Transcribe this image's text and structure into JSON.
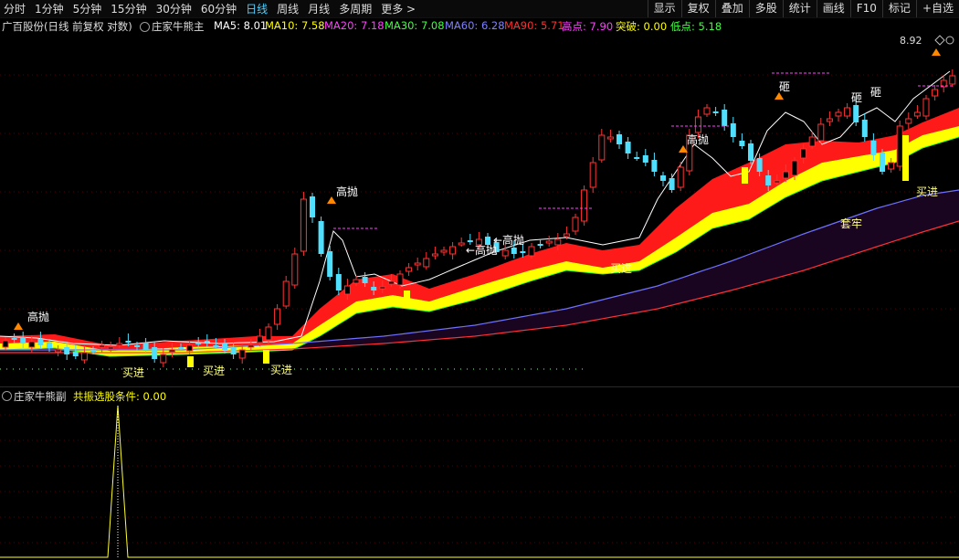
{
  "toolbar": {
    "periods": [
      "分时",
      "1分钟",
      "5分钟",
      "15分钟",
      "30分钟",
      "60分钟",
      "日线",
      "周线",
      "月线",
      "多周期",
      "更多 >"
    ],
    "active_period": "日线",
    "right_buttons": [
      "显示",
      "复权",
      "叠加",
      "多股",
      "统计",
      "画线",
      "F10",
      "标记",
      "+自选"
    ]
  },
  "info": {
    "stock": "广百股份(日线 前复权 对数)",
    "indicator": "庄家牛熊主",
    "ma5": "MA5: 8.01",
    "ma10": "MA10: 7.58",
    "ma20": "MA20: 7.18",
    "ma30": "MA30: 7.08",
    "ma60": "MA60: 6.28",
    "ma90": "MA90: 5.71",
    "high": "高点: 7.90",
    "breakout": "突破: 0.00",
    "low": "低点: 5.18",
    "colors": {
      "ma5": "#ffffff",
      "ma10": "#ffff00",
      "ma20": "#ff40ff",
      "ma30": "#40ff40",
      "ma60": "#8080ff",
      "ma90": "#ff3030",
      "high": "#ff40ff",
      "breakout": "#ffff00",
      "low": "#40ff40"
    }
  },
  "price_marker": "8.92",
  "annotations": [
    {
      "text": "高抛",
      "kind": "sell"
    },
    {
      "text": "高抛",
      "kind": "sell"
    },
    {
      "text": "←高抛",
      "kind": "sell"
    },
    {
      "text": "←高抛",
      "kind": "sell"
    },
    {
      "text": "高抛",
      "kind": "sell"
    },
    {
      "text": "砸",
      "kind": "sell"
    },
    {
      "text": "砸",
      "kind": "sell"
    },
    {
      "text": "砸",
      "kind": "sell"
    },
    {
      "text": "买进",
      "kind": "buy"
    },
    {
      "text": "买进",
      "kind": "buy"
    },
    {
      "text": "买进",
      "kind": "buy"
    },
    {
      "text": "买进",
      "kind": "buy"
    },
    {
      "text": "买进",
      "kind": "buy"
    },
    {
      "text": "套牢",
      "kind": "buy"
    }
  ],
  "sub": {
    "indicator": "庄家牛熊副",
    "condition": "共振选股条件: 0.00"
  }
}
